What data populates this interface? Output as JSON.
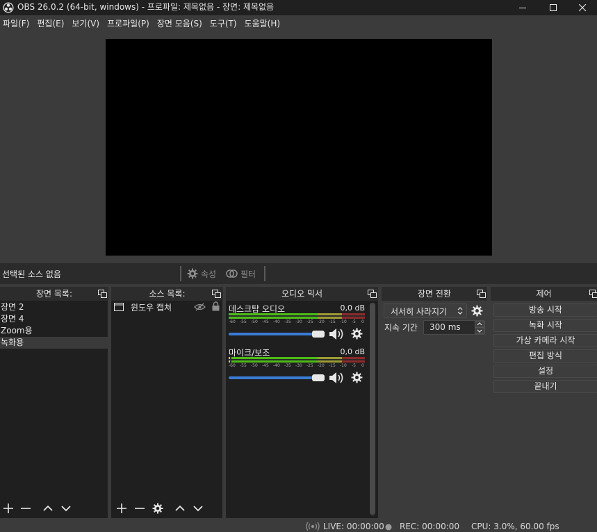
{
  "window": {
    "title": "OBS 26.0.2 (64-bit, windows) - 프로파일: 제목없음 - 장면: 제목없음"
  },
  "menu": [
    {
      "label": "파일(F)"
    },
    {
      "label": "편집(E)"
    },
    {
      "label": "보기(V)"
    },
    {
      "label": "프로파일(P)"
    },
    {
      "label": "장면 모음(S)"
    },
    {
      "label": "도구(T)"
    },
    {
      "label": "도움말(H)"
    }
  ],
  "context": {
    "no_source": "선택된 소스 없음",
    "properties": "속성",
    "filters": "필터"
  },
  "scenes": {
    "title": "장면 목록:",
    "items": [
      "장면 2",
      "장면 4",
      "Zoom용",
      "녹화용"
    ],
    "selected_index": 3
  },
  "sources": {
    "title": "소스 목록:",
    "items": [
      {
        "label": "윈도우 캡쳐",
        "visible": false,
        "locked": true
      }
    ]
  },
  "mixer": {
    "title": "오디오 믹서",
    "ticks": [
      "-60",
      "-55",
      "-50",
      "-45",
      "-40",
      "-35",
      "-30",
      "-25",
      "-20",
      "-15",
      "-10",
      "-5",
      "0"
    ],
    "channels": [
      {
        "name": "데스크탑 오디오",
        "db": "0,0 dB"
      },
      {
        "name": "마이크/보조",
        "db": "0,0 dB"
      }
    ]
  },
  "transitions": {
    "title": "장면 전환",
    "selected": "서서히 사라지기",
    "duration_label": "지속 기간",
    "duration_value": "300 ms"
  },
  "controls": {
    "title": "제어",
    "buttons": [
      "방송 시작",
      "녹화 시작",
      "가상 카메라 시작",
      "편집 방식",
      "설정",
      "끝내기"
    ]
  },
  "status": {
    "live": "LIVE: 00:00:00",
    "rec": "REC: 00:00:00",
    "cpu": "CPU: 3.0%, 60.00 fps"
  },
  "colors": {
    "background": "#3b3b3b",
    "dock_body": "#1f1f1f",
    "meter_green": "#4cbb17",
    "meter_yellow": "#9e9a33",
    "meter_red": "#8a2a2a",
    "slider_blue": "#3a7bd5"
  }
}
